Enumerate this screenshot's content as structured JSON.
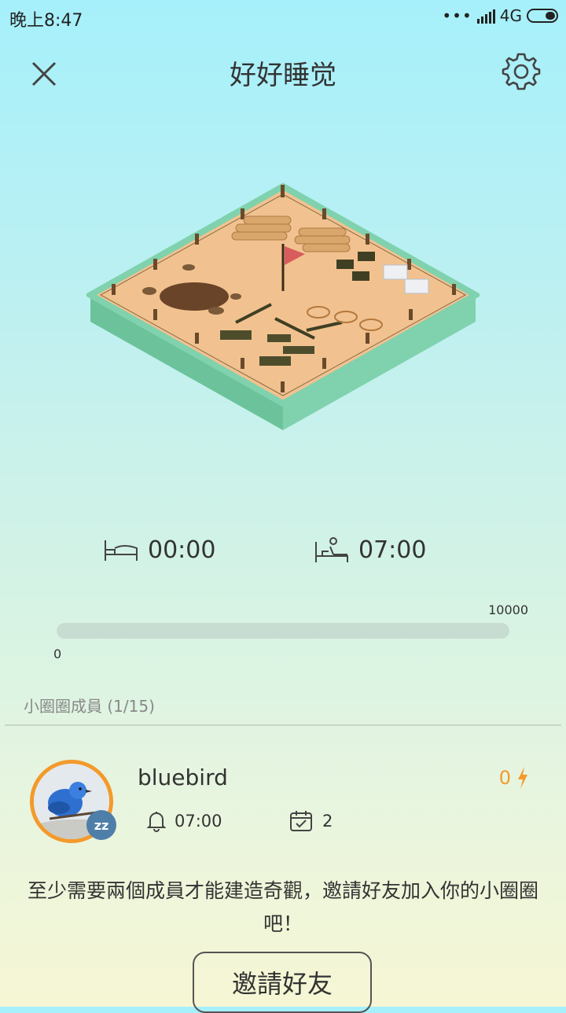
{
  "status": {
    "time": "晚上8:47",
    "dots": "•••",
    "network": "4G"
  },
  "header": {
    "title": "好好睡觉"
  },
  "schedule": {
    "bed_time": "00:00",
    "wake_time": "07:00"
  },
  "progress": {
    "min_label": "0",
    "max_label": "10000",
    "value_fraction": 0
  },
  "members": {
    "title": "小圈圈成員 (1/15)",
    "items": [
      {
        "name": "bluebird",
        "alarm": "07:00",
        "days": "2",
        "score": "0",
        "badge": "zz"
      }
    ]
  },
  "hint": "至少需要兩個成員才能建造奇觀，邀請好友加入你的小圈圈吧！",
  "invite_label": "邀請好友",
  "colors": {
    "accent": "#f39a2b",
    "badge": "#4e7fa9",
    "track": "#c8ddd2"
  },
  "icons": [
    "close-icon",
    "gear-icon",
    "bed-icon",
    "wake-up-icon",
    "bell-icon",
    "calendar-check-icon",
    "lightning-icon",
    "sleeping-badge-icon"
  ]
}
